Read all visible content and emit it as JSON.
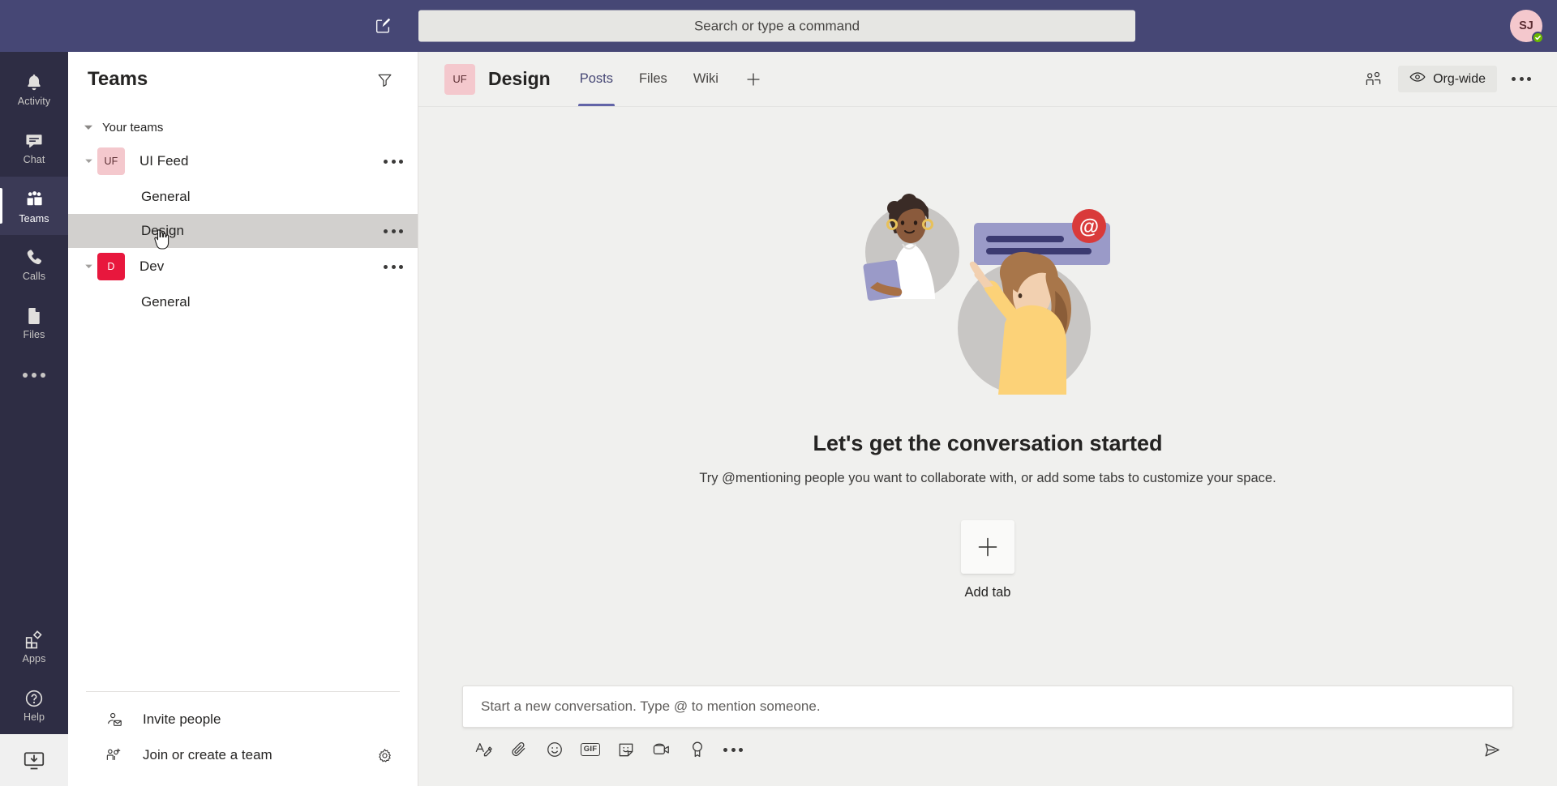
{
  "topbar": {
    "compose_icon": "compose-pencil-icon",
    "search_placeholder": "Search or type a command",
    "search_value": "",
    "avatar_initials": "SJ",
    "presence": "available"
  },
  "rail": {
    "items": [
      {
        "label": "Activity",
        "icon": "bell-icon",
        "active": false
      },
      {
        "label": "Chat",
        "icon": "chat-bubble-icon",
        "active": false
      },
      {
        "label": "Teams",
        "icon": "teams-people-icon",
        "active": true
      },
      {
        "label": "Calls",
        "icon": "phone-icon",
        "active": false
      },
      {
        "label": "Files",
        "icon": "file-icon",
        "active": false
      }
    ],
    "more_label": "...",
    "apps": {
      "label": "Apps",
      "icon": "apps-grid-icon"
    },
    "help": {
      "label": "Help",
      "icon": "help-question-icon"
    },
    "download_app": {
      "icon": "download-desktop-app-icon"
    }
  },
  "teams_panel": {
    "title": "Teams",
    "filter_icon": "filter-funnel-icon",
    "group_label": "Your teams",
    "teams": [
      {
        "name": "UI Feed",
        "initials": "UF",
        "avatar_bg": "#f4c8cd",
        "avatar_fg": "#5c2e33",
        "expanded": true,
        "channels": [
          {
            "name": "General",
            "selected": false
          },
          {
            "name": "Design",
            "selected": true
          }
        ]
      },
      {
        "name": "Dev",
        "initials": "D",
        "avatar_bg": "#e8173d",
        "avatar_fg": "#ffffff",
        "expanded": true,
        "channels": [
          {
            "name": "General",
            "selected": false
          }
        ]
      }
    ],
    "footer": {
      "invite_label": "Invite people",
      "invite_icon": "person-mail-icon",
      "join_label": "Join or create a team",
      "join_icon": "person-add-icon",
      "settings_icon": "gear-icon"
    }
  },
  "channel": {
    "team_initials": "UF",
    "name": "Design",
    "tabs": [
      {
        "label": "Posts",
        "active": true
      },
      {
        "label": "Files",
        "active": false
      },
      {
        "label": "Wiki",
        "active": false
      }
    ],
    "add_tab_icon": "plus-icon",
    "people_icon": "people-team-icon",
    "org_wide_label": "Org-wide",
    "org_wide_icon": "eye-icon",
    "more_icon": "more-horizontal-icon"
  },
  "empty_state": {
    "illustration": "two-people-mention-illustration",
    "title": "Let's get the conversation started",
    "subtitle": "Try @mentioning people you want to collaborate with, or add some tabs to customize your space.",
    "add_tab_label": "Add tab",
    "add_tab_icon": "plus-icon"
  },
  "compose": {
    "placeholder": "Start a new conversation. Type @ to mention someone.",
    "value": "",
    "tools": [
      {
        "name": "format-text-icon",
        "label": "Format"
      },
      {
        "name": "attach-paperclip-icon",
        "label": "Attach"
      },
      {
        "name": "emoji-smiley-icon",
        "label": "Emoji"
      },
      {
        "name": "gif-icon",
        "label": "GIF"
      },
      {
        "name": "sticker-icon",
        "label": "Sticker"
      },
      {
        "name": "meet-now-video-icon",
        "label": "Meet now"
      },
      {
        "name": "praise-award-icon",
        "label": "Praise"
      },
      {
        "name": "more-options-icon",
        "label": "More options"
      }
    ],
    "send_icon": "send-paper-plane-icon"
  },
  "colors": {
    "brand_purple": "#464775",
    "accent_purple": "#6264a7",
    "rail_dark": "#2e2d44",
    "content_bg": "#f0f0ee",
    "selected_row": "#d2d0ce",
    "presence_green": "#6bb700",
    "mention_red": "#d93a3a"
  }
}
